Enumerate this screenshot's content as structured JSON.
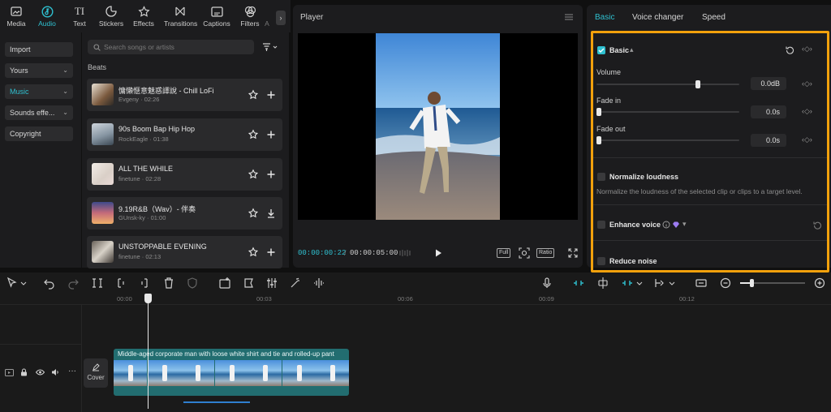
{
  "top_tabs": [
    {
      "label": "Media",
      "icon": "media-icon"
    },
    {
      "label": "Audio",
      "icon": "audio-icon"
    },
    {
      "label": "Text",
      "icon": "text-icon"
    },
    {
      "label": "Stickers",
      "icon": "stickers-icon"
    },
    {
      "label": "Effects",
      "icon": "effects-icon"
    },
    {
      "label": "Transitions",
      "icon": "transitions-icon"
    },
    {
      "label": "Captions",
      "icon": "captions-icon"
    },
    {
      "label": "Filters",
      "icon": "filters-icon"
    },
    {
      "label": "A",
      "icon": "adjust-icon"
    }
  ],
  "active_top_tab": "Audio",
  "categories": [
    {
      "label": "Import"
    },
    {
      "label": "Yours"
    },
    {
      "label": "Music"
    },
    {
      "label": "Sounds effe..."
    },
    {
      "label": "Copyright"
    }
  ],
  "search": {
    "placeholder": "Search songs or artists"
  },
  "section_title": "Beats",
  "songs": [
    {
      "name": "慵懶愜意魅惑譯說 - Chill LoFi",
      "artist": "Evgeny",
      "duration": "02:26",
      "action": "add"
    },
    {
      "name": "90s Boom Bap Hip Hop",
      "artist": "RockEagle",
      "duration": "01:38",
      "action": "add"
    },
    {
      "name": "ALL THE WHILE",
      "artist": "finetune",
      "duration": "02:28",
      "action": "add"
    },
    {
      "name": "9.19R&B（Wav）- 伴奏",
      "artist": "GUnsk-ky",
      "duration": "01:00",
      "action": "download"
    },
    {
      "name": "UNSTOPPABLE EVENING",
      "artist": "finetune",
      "duration": "02:13",
      "action": "add"
    }
  ],
  "player": {
    "title": "Player",
    "current_time": "00:00:00:22",
    "separator": "/",
    "total_time": "00:00:05:00",
    "full_label": "Full",
    "ratio_label": "Ratio"
  },
  "right_panel": {
    "tabs": [
      "Basic",
      "Voice changer",
      "Speed"
    ],
    "active_tab": "Basic",
    "basic_label": "Basic",
    "volume": {
      "label": "Volume",
      "value": "0.0dB",
      "level": 0.72
    },
    "fade_in": {
      "label": "Fade in",
      "value": "0.0s",
      "level": 0
    },
    "fade_out": {
      "label": "Fade out",
      "value": "0.0s",
      "level": 0
    },
    "normalize": {
      "label": "Normalize loudness",
      "description": "Normalize the loudness of the selected clip or clips to a target level.",
      "checked": false
    },
    "enhance": {
      "label": "Enhance voice",
      "checked": false
    },
    "reduce_noise": {
      "label": "Reduce noise",
      "checked": false
    }
  },
  "timeline": {
    "ticks": [
      "00:00",
      "00:03",
      "00:06",
      "00:09",
      "00:12"
    ],
    "cover_label": "Cover",
    "clip_label": "Middle-aged corporate man with loose white shirt and tie and rolled-up pant"
  },
  "colors": {
    "accent": "#2fc0d0",
    "highlight": "#f2a10c",
    "clip": "#226d70"
  }
}
